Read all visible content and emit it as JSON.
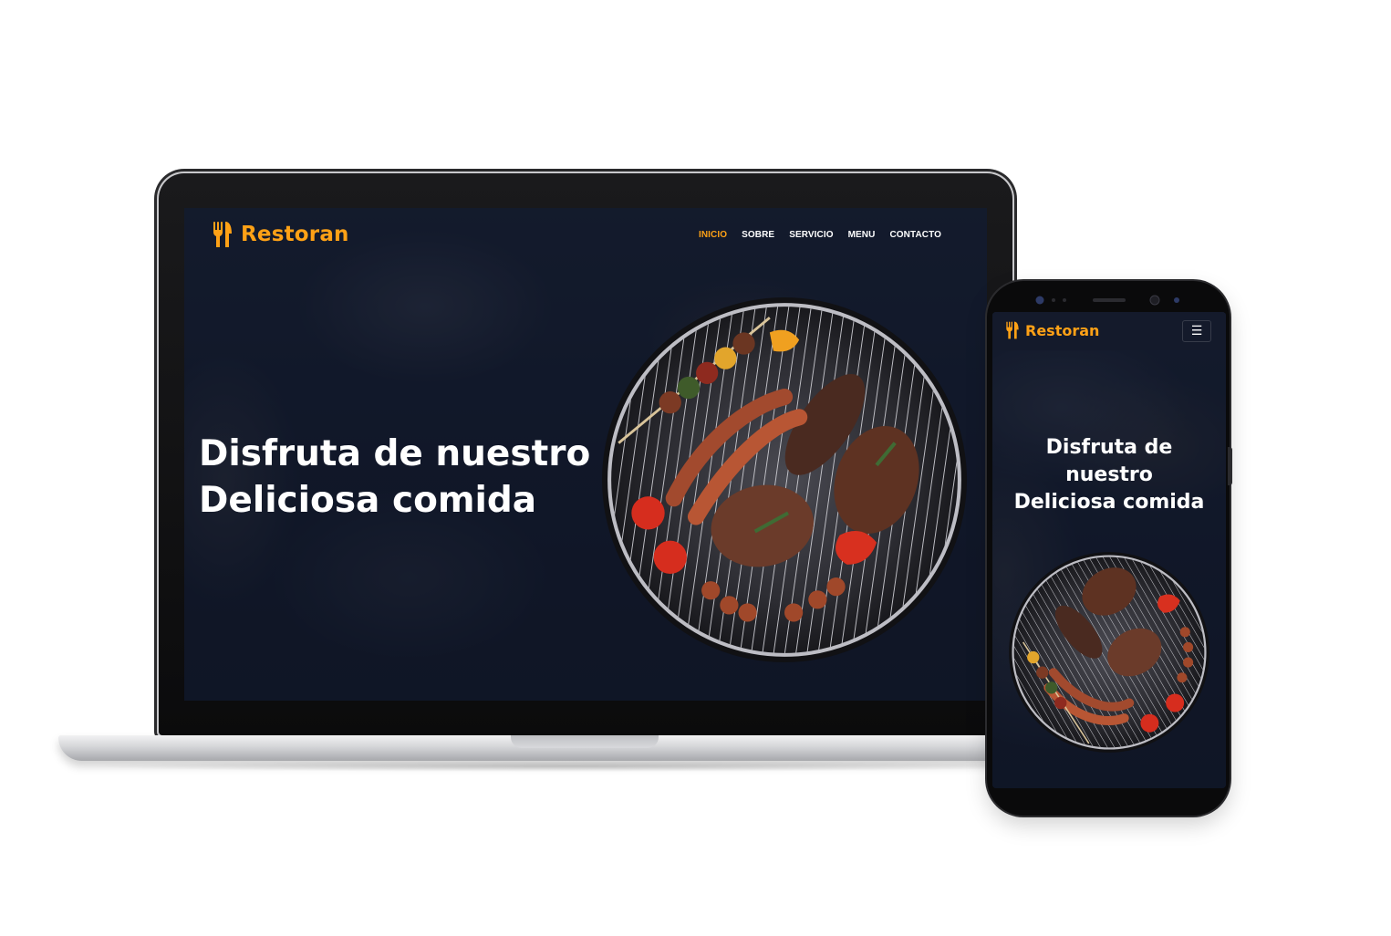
{
  "brand": {
    "name": "Restoran",
    "accent_color": "#FEA116",
    "logo_icon": "utensils-icon"
  },
  "desktop": {
    "nav": {
      "items": [
        "INICIO",
        "SOBRE",
        "SERVICIO",
        "MENU",
        "CONTACTO"
      ],
      "active": "INICIO"
    },
    "hero": {
      "headline_line1": "Disfruta de nuestro",
      "headline_line2": "Deliciosa comida",
      "image": "bbq-grill-image"
    }
  },
  "mobile": {
    "menu_icon": "hamburger-icon",
    "hero": {
      "headline_line1": "Disfruta de",
      "headline_line2": "nuestro",
      "headline_line3": "Deliciosa comida",
      "image": "bbq-grill-image"
    }
  },
  "colors": {
    "hero_overlay": "#0F172B",
    "text": "#FFFFFF"
  }
}
